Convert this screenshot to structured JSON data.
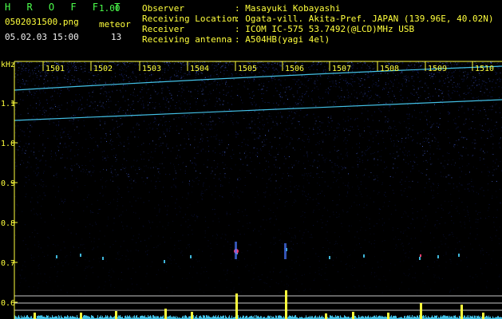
{
  "header": {
    "app_name": "H R O F F T",
    "version": "1.00",
    "filename": "0502031500.png",
    "datetime": "05.02.03 15:00",
    "meteor_label": "meteor",
    "meteor_count": "13"
  },
  "info": [
    {
      "key": "Observer",
      "value": ": Masayuki Kobayashi"
    },
    {
      "key": "Receiving Location",
      "value": ": Ogata-vill. Akita-Pref. JAPAN (139.96E, 40.02N)"
    },
    {
      "key": "Receiver",
      "value": ": ICOM IC-575 53.7492(@LCD)MHz USB"
    },
    {
      "key": "Receiving antenna",
      "value": ": A504HB(yagi 4el)"
    }
  ],
  "axis": {
    "unit": "kHz",
    "time_ticks": [
      "1501",
      "1502",
      "1503",
      "1504",
      "1505",
      "1506",
      "1507",
      "1508",
      "1509",
      "1510"
    ],
    "freq_ticks": [
      "1.1",
      "1.0",
      "0.9",
      "0.8",
      "0.7",
      "0.6"
    ]
  },
  "colors": {
    "background": "#000000",
    "noise": "#1a2a8c",
    "label_yellow": "#ffff3c",
    "title_green": "#4cff4c",
    "trace_cyan": "#4ad6ff"
  }
}
